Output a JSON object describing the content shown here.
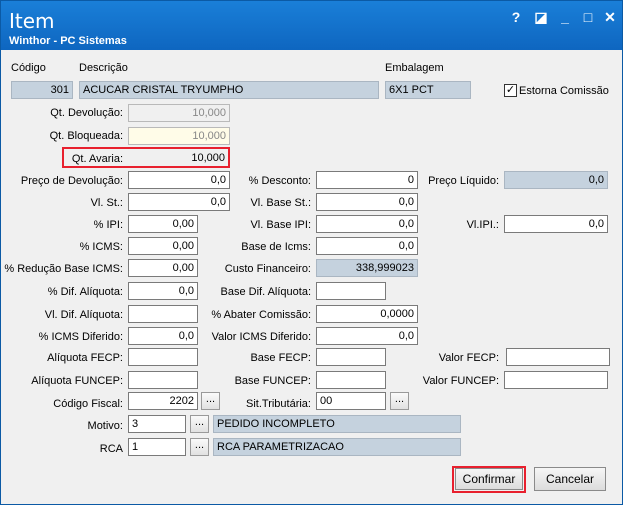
{
  "window": {
    "title": "Item",
    "subtitle": "Winthor - PC Sistemas",
    "help_icon": "?",
    "restore_icon": "◪",
    "minimize_icon": "_",
    "maximize_icon": "□",
    "close_icon": "✕"
  },
  "header": {
    "codigo_label": "Código",
    "descricao_label": "Descrição",
    "embalagem_label": "Embalagem",
    "codigo_value": "301",
    "descricao_value": "ACUCAR CRISTAL TRYUMPHO",
    "embalagem_value": "6X1 PCT",
    "estorna_label": "Estorna Comissão",
    "estorna_checked": "✓"
  },
  "fields": {
    "qt_devolucao_label": "Qt. Devolução:",
    "qt_devolucao_value": "10,000",
    "qt_bloqueada_label": "Qt. Bloqueada:",
    "qt_bloqueada_value": "10,000",
    "qt_avaria_label": "Qt. Avaria:",
    "qt_avaria_value": "10,000",
    "preco_devolucao_label": "Preço de Devolução:",
    "preco_devolucao_value": "0,0",
    "desconto_label": "% Desconto:",
    "desconto_value": "0",
    "preco_liquido_label": "Preço Líquido:",
    "preco_liquido_value": "0,0",
    "vl_st_label": "Vl. St.:",
    "vl_st_value": "0,0",
    "vl_base_st_label": "Vl. Base St.:",
    "vl_base_st_value": "0,0",
    "ipi_label": "% IPI:",
    "ipi_value": "0,00",
    "vl_base_ipi_label": "Vl. Base IPI:",
    "vl_base_ipi_value": "0,0",
    "vl_ipi_label": "Vl.IPI.:",
    "vl_ipi_value": "0,0",
    "icms_label": "% ICMS:",
    "icms_value": "0,00",
    "base_icms_label": "Base de Icms:",
    "base_icms_value": "0,0",
    "reducao_label": "% Redução Base ICMS:",
    "reducao_value": "0,00",
    "custo_label": "Custo Financeiro:",
    "custo_value": "338,999023",
    "dif_aliquota_label": "% Dif. Alíquota:",
    "dif_aliquota_value": "0,0",
    "base_dif_label": "Base Dif. Alíquota:",
    "base_dif_value": "",
    "vl_dif_label": "Vl. Dif. Alíquota:",
    "vl_dif_value": "",
    "abater_label": "% Abater Comissão:",
    "abater_value": "0,0000",
    "icms_diferido_label": "% ICMS Diferido:",
    "icms_diferido_value": "0,0",
    "valor_icms_dif_label": "Valor ICMS Diferido:",
    "valor_icms_dif_value": "0,0",
    "aliq_fecp_label": "Alíquota FECP:",
    "aliq_fecp_value": "",
    "base_fecp_label": "Base FECP:",
    "base_fecp_value": "",
    "valor_fecp_label": "Valor FECP:",
    "valor_fecp_value": "",
    "aliq_funcep_label": "Alíquota FUNCEP:",
    "aliq_funcep_value": "",
    "base_funcep_label": "Base FUNCEP:",
    "base_funcep_value": "",
    "valor_funcep_label": "Valor FUNCEP:",
    "valor_funcep_value": "",
    "codigo_fiscal_label": "Código Fiscal:",
    "codigo_fiscal_value": "2202",
    "sit_trib_label": "Sit.Tributária:",
    "sit_trib_value": "00",
    "motivo_label": "Motivo:",
    "motivo_code": "3",
    "motivo_desc": "PEDIDO INCOMPLETO",
    "rca_label": "RCA",
    "rca_code": "1",
    "rca_desc": "RCA PARAMETRIZACAO",
    "dots": "..."
  },
  "buttons": {
    "confirmar": "Confirmar",
    "cancelar": "Cancelar"
  },
  "colors": {
    "titlebar": "#1a7fd8",
    "highlight": "#e8202e"
  }
}
